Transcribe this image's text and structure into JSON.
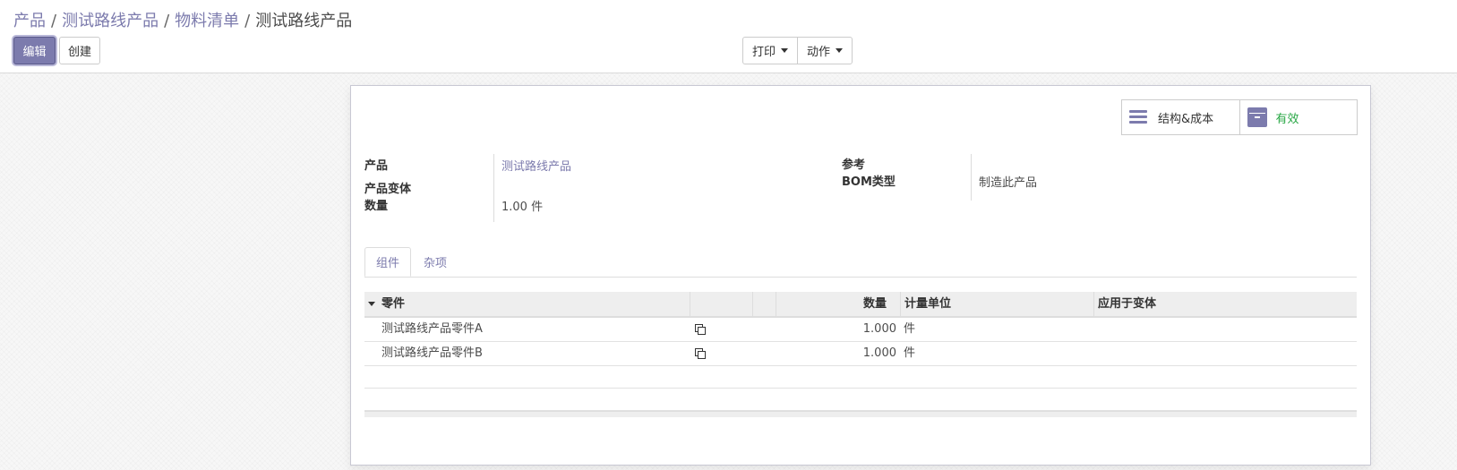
{
  "breadcrumb": {
    "items": [
      "产品",
      "测试路线产品",
      "物料清单"
    ],
    "separator": "/",
    "current": "测试路线产品"
  },
  "toolbar": {
    "edit_label": "编辑",
    "create_label": "创建",
    "print_label": "打印",
    "action_label": "动作"
  },
  "button_box": {
    "structure_cost_label": "结构&成本",
    "active_label": "有效"
  },
  "form": {
    "product_label": "产品",
    "product_value": "测试路线产品",
    "variant_label": "产品变体",
    "variant_value": "",
    "quantity_label": "数量",
    "quantity_value": "1.00 件",
    "reference_label": "参考",
    "reference_value": "",
    "bom_type_label": "BOM类型",
    "bom_type_value": "制造此产品"
  },
  "tabs": [
    "组件",
    "杂项"
  ],
  "table": {
    "headers": {
      "component": "零件",
      "quantity": "数量",
      "uom": "计量单位",
      "apply_on_variants": "应用于变体"
    },
    "rows": [
      {
        "component": "测试路线产品零件A",
        "quantity": "1.000",
        "uom": "件"
      },
      {
        "component": "测试路线产品零件B",
        "quantity": "1.000",
        "uom": "件"
      }
    ]
  },
  "colors": {
    "brand": "#7c7bad",
    "active_green": "#28a745"
  }
}
